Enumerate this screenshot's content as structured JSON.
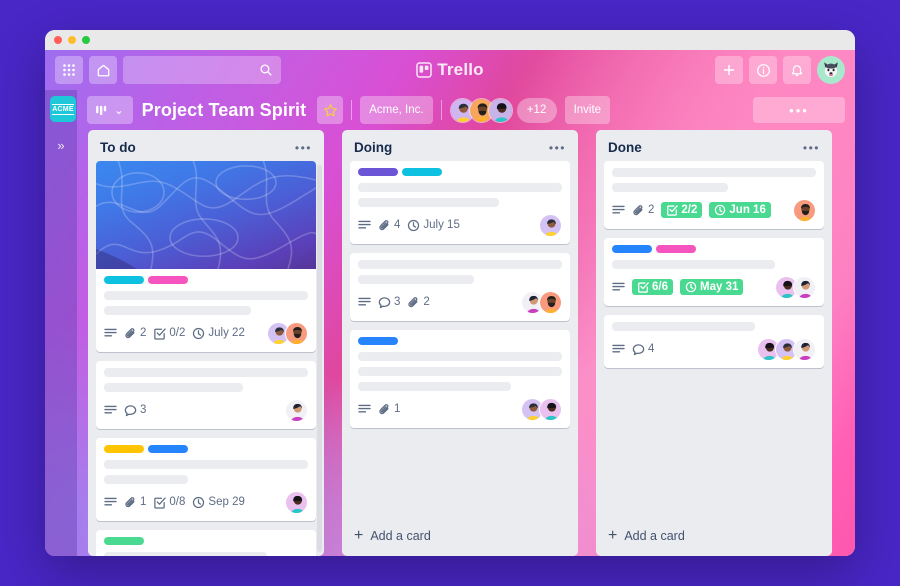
{
  "window": {
    "traffic_lights": [
      "close",
      "minimize",
      "maximize"
    ]
  },
  "topnav": {
    "apps_grid_label": "apps-grid",
    "home_label": "home",
    "search_placeholder": "",
    "search_value": "",
    "brand": "Trello",
    "add_label": "+",
    "info_label": "i",
    "notifications_label": "notifications",
    "account_avatar": "husky-dog"
  },
  "boardbar": {
    "board_menu_icon": "board-columns-icon",
    "board_menu_chevron": "⌄",
    "title": "Project Team Spirit",
    "star": "★",
    "team": "Acme, Inc.",
    "extra_members": "+12",
    "invite_label": "Invite",
    "overflow": "•••"
  },
  "sidebar": {
    "logo_text": "ACME",
    "expand_icon": "»"
  },
  "colors": {
    "label_cyan": "#0FC1E0",
    "label_pink": "#F553BE",
    "label_purple": "#6B55D6",
    "label_blue": "#2684FF",
    "label_yellow": "#FFC400",
    "label_green": "#4AD991",
    "badge_done_green": "#4AD991",
    "page_bg": "#4926C6"
  },
  "lists": [
    {
      "title": "To do",
      "menu": "•••",
      "has_scrollbar": true,
      "add_card_label": null,
      "cards": [
        {
          "cover": "blue-gradient-waves",
          "labels": [
            "#0FC1E0",
            "#F553BE"
          ],
          "lines": [
            100,
            72
          ],
          "badges": [
            {
              "type": "description",
              "text": ""
            },
            {
              "type": "attachment",
              "text": "2"
            },
            {
              "type": "checklist",
              "text": "0/2"
            },
            {
              "type": "due",
              "text": "July 22"
            }
          ],
          "avatars": [
            "purple-yellow",
            "orange-beard"
          ]
        },
        {
          "cover": null,
          "labels": [],
          "lines": [
            100,
            68
          ],
          "badges": [
            {
              "type": "description",
              "text": ""
            },
            {
              "type": "comment",
              "text": "3"
            }
          ],
          "avatars": [
            "white-magenta"
          ]
        },
        {
          "cover": null,
          "labels": [
            "#FFC400",
            "#2684FF"
          ],
          "lines": [
            100,
            41
          ],
          "badges": [
            {
              "type": "description",
              "text": ""
            },
            {
              "type": "attachment",
              "text": "1"
            },
            {
              "type": "checklist",
              "text": "0/8"
            },
            {
              "type": "due",
              "text": "Sep 29"
            }
          ],
          "avatars": [
            "pink-teal"
          ]
        },
        {
          "cover": null,
          "labels": [
            "#4AD991"
          ],
          "lines": [
            80
          ],
          "badges": [],
          "avatars": []
        }
      ]
    },
    {
      "title": "Doing",
      "menu": "•••",
      "has_scrollbar": false,
      "add_card_label": "Add a card",
      "cards": [
        {
          "cover": null,
          "labels": [
            "#6B55D6",
            "#0FC1E0"
          ],
          "lines": [
            100,
            69
          ],
          "badges": [
            {
              "type": "description",
              "text": ""
            },
            {
              "type": "attachment",
              "text": "4"
            },
            {
              "type": "due",
              "text": "July 15"
            }
          ],
          "avatars": [
            "purple-yellow"
          ]
        },
        {
          "cover": null,
          "labels": [],
          "lines": [
            100,
            57
          ],
          "badges": [
            {
              "type": "description",
              "text": ""
            },
            {
              "type": "comment",
              "text": "3"
            },
            {
              "type": "attachment",
              "text": "2"
            }
          ],
          "avatars": [
            "white-magenta",
            "orange-beard"
          ]
        },
        {
          "cover": null,
          "labels": [
            "#2684FF"
          ],
          "lines": [
            100,
            100,
            75
          ],
          "badges": [
            {
              "type": "description",
              "text": ""
            },
            {
              "type": "attachment",
              "text": "1"
            }
          ],
          "avatars": [
            "purple-yellow",
            "pink-teal"
          ]
        }
      ]
    },
    {
      "title": "Done",
      "menu": "•••",
      "has_scrollbar": false,
      "add_card_label": "Add a card",
      "cards": [
        {
          "cover": null,
          "labels": [],
          "lines": [
            100,
            57
          ],
          "badges": [
            {
              "type": "description",
              "text": ""
            },
            {
              "type": "attachment",
              "text": "2"
            },
            {
              "type": "checklist-done",
              "text": "2/2"
            },
            {
              "type": "due-done",
              "text": "Jun 16"
            }
          ],
          "avatars": [
            "orange-beard"
          ]
        },
        {
          "cover": null,
          "labels": [
            "#2684FF",
            "#F553BE"
          ],
          "lines": [
            80
          ],
          "badges": [
            {
              "type": "description",
              "text": ""
            },
            {
              "type": "checklist-done",
              "text": "6/6"
            },
            {
              "type": "due-done",
              "text": "May 31"
            }
          ],
          "avatars": [
            "pink-teal",
            "white-magenta"
          ]
        },
        {
          "cover": null,
          "labels": [],
          "lines": [
            70
          ],
          "badges": [
            {
              "type": "description",
              "text": ""
            },
            {
              "type": "comment",
              "text": "4"
            }
          ],
          "avatars": [
            "pink-teal",
            "purple-yellow",
            "white-magenta"
          ]
        }
      ]
    }
  ]
}
